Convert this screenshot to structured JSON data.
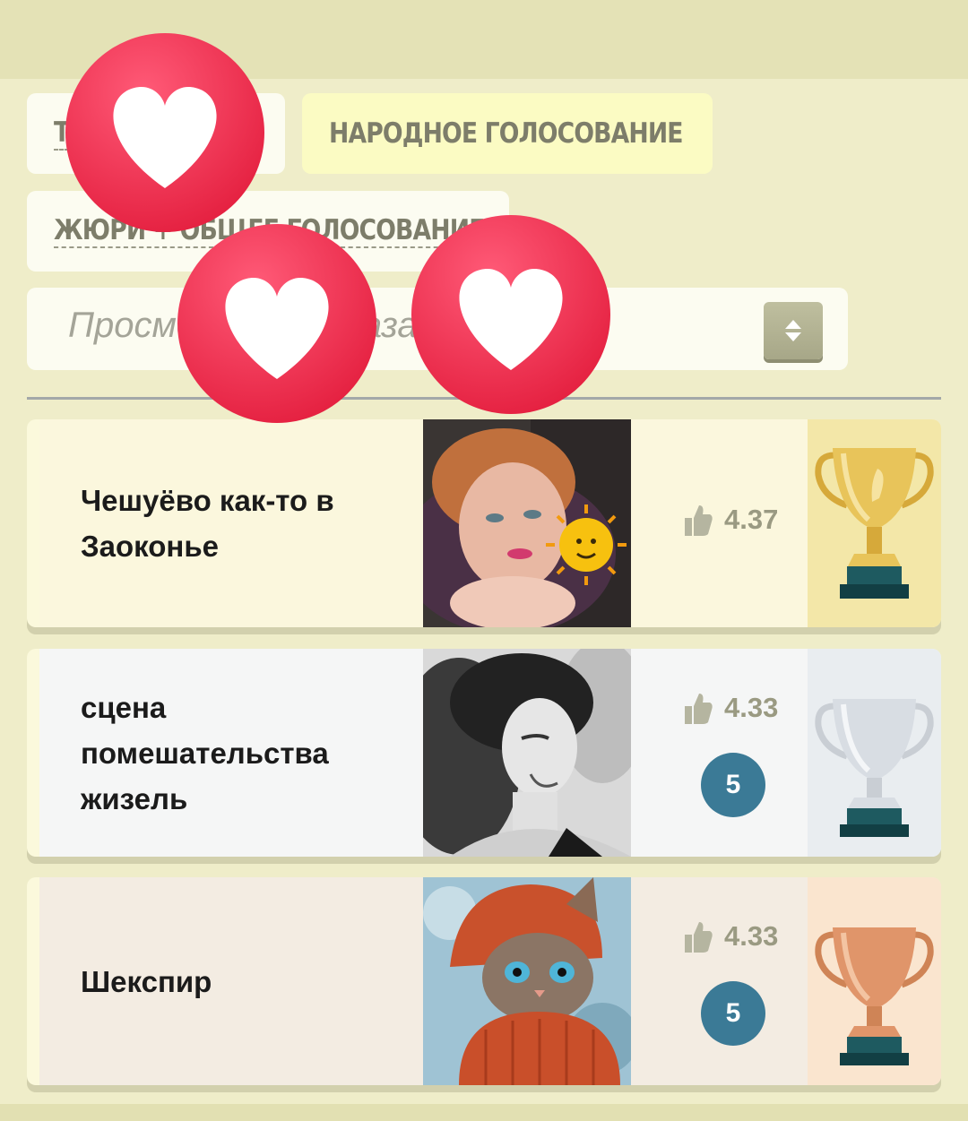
{
  "tabs": [
    {
      "label": "Т",
      "active": false
    },
    {
      "label": "НАРОДНОЕ ГОЛОСОВАНИЕ",
      "active": true
    },
    {
      "label": "ЖЮРИ + ОБЩЕЕ ГОЛОСОВАНИЕ",
      "active": false
    }
  ],
  "sort_select": {
    "placeholder": "Просмотр по показателей"
  },
  "entries": [
    {
      "title_lines": [
        "Чешуёво как-то в",
        "Заоконье"
      ],
      "rating": "4.37",
      "badge": "",
      "trophy": "gold-trophy-icon",
      "thumb": "woman-with-sun-photo"
    },
    {
      "title_lines": [
        "сцена",
        "помешательства",
        "жизель"
      ],
      "rating": "4.33",
      "badge": "5",
      "trophy": "silver-trophy-icon",
      "thumb": "woman-black-white-photo"
    },
    {
      "title_lines": [
        "Шекспир"
      ],
      "rating": "4.33",
      "badge": "5",
      "trophy": "bronze-trophy-icon",
      "thumb": "cat-in-hat-photo"
    }
  ],
  "colors": {
    "page_bg": "#efedc9",
    "active_tab": "#fbfbc3",
    "badge": "#3b7a96",
    "heart_bubble": "#ec2f4b",
    "gold": "#e8c45a",
    "silver": "#d8dde3",
    "bronze": "#e0956a"
  },
  "overlay": {
    "icon": "heart-reaction-icon",
    "count": 3
  }
}
